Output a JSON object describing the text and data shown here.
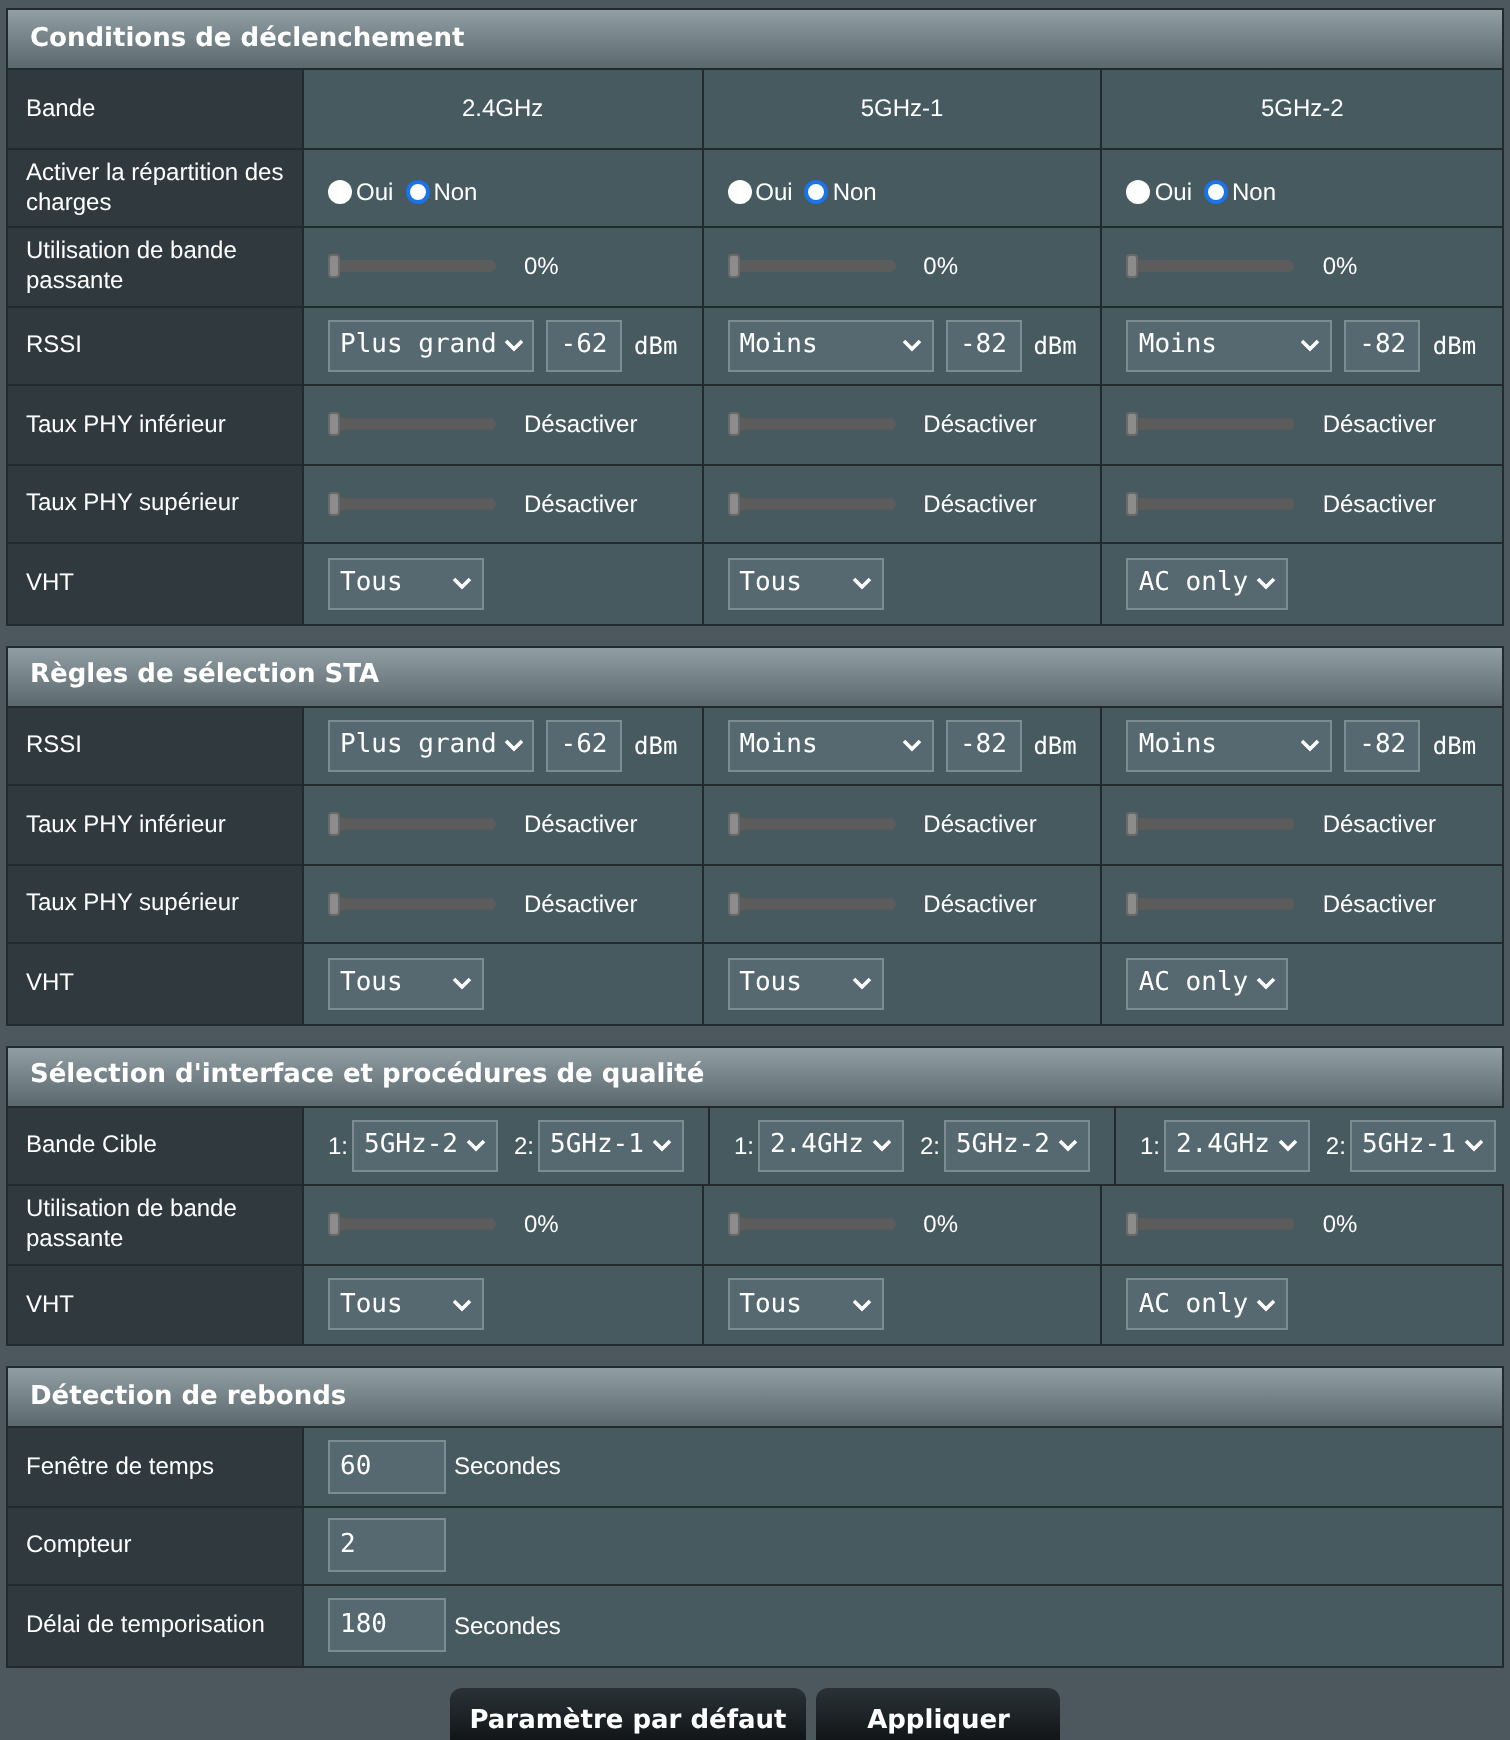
{
  "sections": [
    {
      "title": "Conditions de déclenchement",
      "rows": [
        {
          "kind": "band",
          "label": "Bande",
          "cells": [
            {
              "text": "2.4GHz"
            },
            {
              "text": "5GHz-1"
            },
            {
              "text": "5GHz-2"
            }
          ]
        },
        {
          "kind": "radio",
          "label": "Activer la répartition des charges",
          "cells": [
            {
              "options": [
                {
                  "label": "Oui",
                  "selected": false
                },
                {
                  "label": "Non",
                  "selected": true
                }
              ]
            },
            {
              "options": [
                {
                  "label": "Oui",
                  "selected": false
                },
                {
                  "label": "Non",
                  "selected": true
                }
              ]
            },
            {
              "options": [
                {
                  "label": "Oui",
                  "selected": false
                },
                {
                  "label": "Non",
                  "selected": true
                }
              ]
            }
          ]
        },
        {
          "kind": "slider",
          "label": "Utilisation de bande passante",
          "cells": [
            {
              "level": 0,
              "reading": "0%"
            },
            {
              "level": 0,
              "reading": "0%"
            },
            {
              "level": 0,
              "reading": "0%"
            }
          ]
        },
        {
          "kind": "rssi",
          "label": "RSSI",
          "cells": [
            {
              "choice": "Plus grand",
              "value": "-62",
              "unit": "dBm"
            },
            {
              "choice": "Moins",
              "value": "-82",
              "unit": "dBm"
            },
            {
              "choice": "Moins",
              "value": "-82",
              "unit": "dBm"
            }
          ]
        },
        {
          "kind": "slider",
          "label": "Taux PHY inférieur",
          "cells": [
            {
              "level": 0,
              "reading": "Désactiver"
            },
            {
              "level": 0,
              "reading": "Désactiver"
            },
            {
              "level": 0,
              "reading": "Désactiver"
            }
          ]
        },
        {
          "kind": "slider",
          "label": "Taux PHY supérieur",
          "cells": [
            {
              "level": 0,
              "reading": "Désactiver"
            },
            {
              "level": 0,
              "reading": "Désactiver"
            },
            {
              "level": 0,
              "reading": "Désactiver"
            }
          ]
        },
        {
          "kind": "select",
          "label": "VHT",
          "cells": [
            {
              "choice": "Tous"
            },
            {
              "choice": "Tous"
            },
            {
              "choice": "AC only"
            }
          ]
        }
      ]
    },
    {
      "title": "Règles de sélection STA",
      "rows": [
        {
          "kind": "rssi",
          "label": "RSSI",
          "cells": [
            {
              "choice": "Plus grand",
              "value": "-62",
              "unit": "dBm"
            },
            {
              "choice": "Moins",
              "value": "-82",
              "unit": "dBm"
            },
            {
              "choice": "Moins",
              "value": "-82",
              "unit": "dBm"
            }
          ]
        },
        {
          "kind": "slider",
          "label": "Taux PHY inférieur",
          "cells": [
            {
              "level": 0,
              "reading": "Désactiver"
            },
            {
              "level": 0,
              "reading": "Désactiver"
            },
            {
              "level": 0,
              "reading": "Désactiver"
            }
          ]
        },
        {
          "kind": "slider",
          "label": "Taux PHY supérieur",
          "cells": [
            {
              "level": 0,
              "reading": "Désactiver"
            },
            {
              "level": 0,
              "reading": "Désactiver"
            },
            {
              "level": 0,
              "reading": "Désactiver"
            }
          ]
        },
        {
          "kind": "select",
          "label": "VHT",
          "cells": [
            {
              "choice": "Tous"
            },
            {
              "choice": "Tous"
            },
            {
              "choice": "AC only"
            }
          ]
        }
      ]
    },
    {
      "title": "Sélection d'interface et procédures de qualité",
      "rows": [
        {
          "kind": "target",
          "label": "Bande Cible",
          "cells": [
            {
              "items": [
                {
                  "prefix": "1:",
                  "choice": "5GHz-2"
                },
                {
                  "prefix": "2:",
                  "choice": "5GHz-1"
                }
              ]
            },
            {
              "items": [
                {
                  "prefix": "1:",
                  "choice": "2.4GHz"
                },
                {
                  "prefix": "2:",
                  "choice": "5GHz-2"
                }
              ]
            },
            {
              "items": [
                {
                  "prefix": "1:",
                  "choice": "2.4GHz"
                },
                {
                  "prefix": "2:",
                  "choice": "5GHz-1"
                }
              ]
            }
          ]
        },
        {
          "kind": "slider",
          "label": "Utilisation de bande passante",
          "cells": [
            {
              "level": 0,
              "reading": "0%"
            },
            {
              "level": 0,
              "reading": "0%"
            },
            {
              "level": 0,
              "reading": "0%"
            }
          ]
        },
        {
          "kind": "select",
          "label": "VHT",
          "cells": [
            {
              "choice": "Tous"
            },
            {
              "choice": "Tous"
            },
            {
              "choice": "AC only"
            }
          ]
        }
      ]
    },
    {
      "title": "Détection de rebonds",
      "rows": [
        {
          "kind": "input",
          "label": "Fenêtre de temps",
          "value": "60",
          "unit": "Secondes"
        },
        {
          "kind": "input",
          "label": "Compteur",
          "value": "2"
        },
        {
          "kind": "input",
          "label": "Délai de temporisation",
          "value": "180",
          "unit": "Secondes"
        }
      ]
    }
  ],
  "buttons": [
    {
      "label": "Paramètre par défaut"
    },
    {
      "label": "Appliquer"
    }
  ]
}
